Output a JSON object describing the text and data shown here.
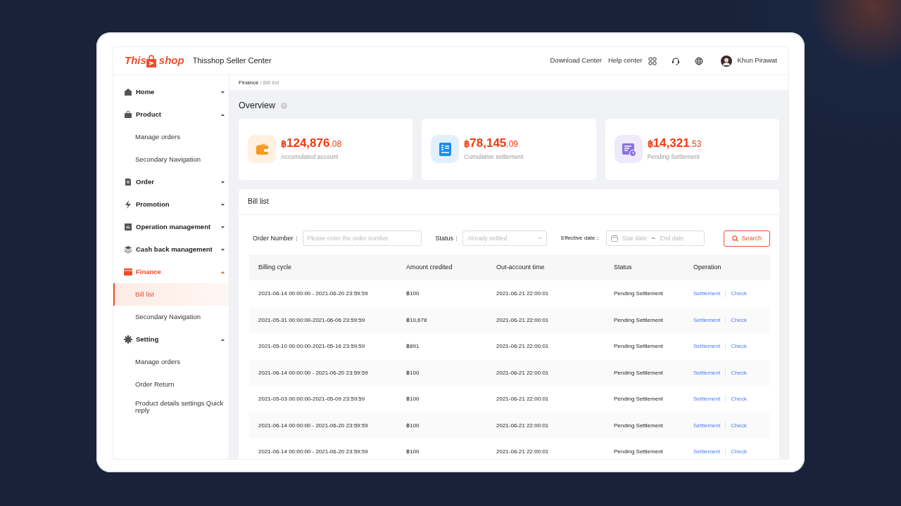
{
  "header": {
    "logo_left": "This",
    "logo_right": "shop",
    "title": "Thisshop Seller Center",
    "links": [
      "Download Center",
      "Help center"
    ],
    "user": "Khun Pirawat"
  },
  "sidebar": {
    "items": [
      {
        "label": "Home",
        "expanded": false,
        "selected": false
      },
      {
        "label": "Product",
        "expanded": true,
        "selected": false,
        "children": [
          {
            "label": "Manage orders",
            "selected": false
          },
          {
            "label": "Secondary Navigation",
            "selected": false
          }
        ]
      },
      {
        "label": "Order",
        "expanded": false,
        "selected": false
      },
      {
        "label": "Promotion",
        "expanded": false,
        "selected": false
      },
      {
        "label": "Operation management",
        "expanded": false,
        "selected": false
      },
      {
        "label": "Cash back management",
        "expanded": false,
        "selected": false
      },
      {
        "label": "Finance",
        "expanded": true,
        "selected": true,
        "children": [
          {
            "label": "Bill list",
            "selected": true
          },
          {
            "label": "Secondary Navigation",
            "selected": false
          }
        ]
      },
      {
        "label": "Setting",
        "expanded": true,
        "selected": false,
        "children": [
          {
            "label": "Manage orders",
            "selected": false
          },
          {
            "label": "Order Return",
            "selected": false
          },
          {
            "label": "Product details settings Quick reply",
            "selected": false
          }
        ]
      }
    ]
  },
  "breadcrumb": [
    "Finance",
    "/",
    "Bill list"
  ],
  "overview": {
    "title": "Overview",
    "cards": [
      {
        "currency": "฿",
        "amount": "124,876",
        "decimals": ".08",
        "label": "Accumulated account"
      },
      {
        "currency": "฿",
        "amount": "78,145",
        "decimals": ".09",
        "label": "Cumulative settlement"
      },
      {
        "currency": "฿",
        "amount": "14,321",
        "decimals": ".53",
        "label": "Pending Settlement"
      }
    ]
  },
  "bill_list": {
    "title": "Bill list",
    "filters": {
      "order_label": "Order Number：",
      "order_placeholder": "Please enter the order number",
      "status_label": "Status：",
      "status_placeholder": "Already settled",
      "date_label": "Effective date：",
      "start_placeholder": "Star date",
      "separator": "~",
      "end_placeholder": "End date",
      "search_button": "Search"
    },
    "columns": [
      "Billing cycle",
      "Amount credited",
      "Out-account time",
      "Status",
      "Operation"
    ],
    "rows": [
      {
        "cycle": "2021-06-14 00:00:00 - 2021-06-20 23:59:59",
        "amount": "฿100",
        "time": "2021-06-21 22:00:01",
        "status": "Pending Settlement",
        "actions": [
          "Settlement",
          "Check"
        ]
      },
      {
        "cycle": "2021-05-31 00:00:00-2021-06-06 23:59:59",
        "amount": "฿10,678",
        "time": "2021-06-21 22:00:01",
        "status": "Pending Settlement",
        "actions": [
          "Settlement",
          "Check"
        ]
      },
      {
        "cycle": "2021-05-10 00:00:00-2021-05-16 23:59:59",
        "amount": "฿891",
        "time": "2021-06-21 22:00:01",
        "status": "Pending Settlement",
        "actions": [
          "Settlement",
          "Check"
        ]
      },
      {
        "cycle": "2021-06-14 00:00:00 - 2021-06-20 23:59:59",
        "amount": "฿100",
        "time": "2021-06-21 22:00:01",
        "status": "Pending Settlement",
        "actions": [
          "Settlement",
          "Check"
        ]
      },
      {
        "cycle": "2021-05-03 00:00:00-2021-05-09 23:59:59",
        "amount": "฿100",
        "time": "2021-06-21 22:00:01",
        "status": "Pending Settlement",
        "actions": [
          "Settlement",
          "Check"
        ]
      },
      {
        "cycle": "2021-06-14 00:00:00 - 2021-06-20 23:59:59",
        "amount": "฿100",
        "time": "2021-06-21 22:00:01",
        "status": "Pending Settlement",
        "actions": [
          "Settlement",
          "Check"
        ]
      },
      {
        "cycle": "2021-06-14 00:00:00 - 2021-06-20 23:59:59",
        "amount": "฿100",
        "time": "2021-06-21 22:00:01",
        "status": "Pending Settlement",
        "actions": [
          "Settlement",
          "Check"
        ]
      }
    ]
  }
}
